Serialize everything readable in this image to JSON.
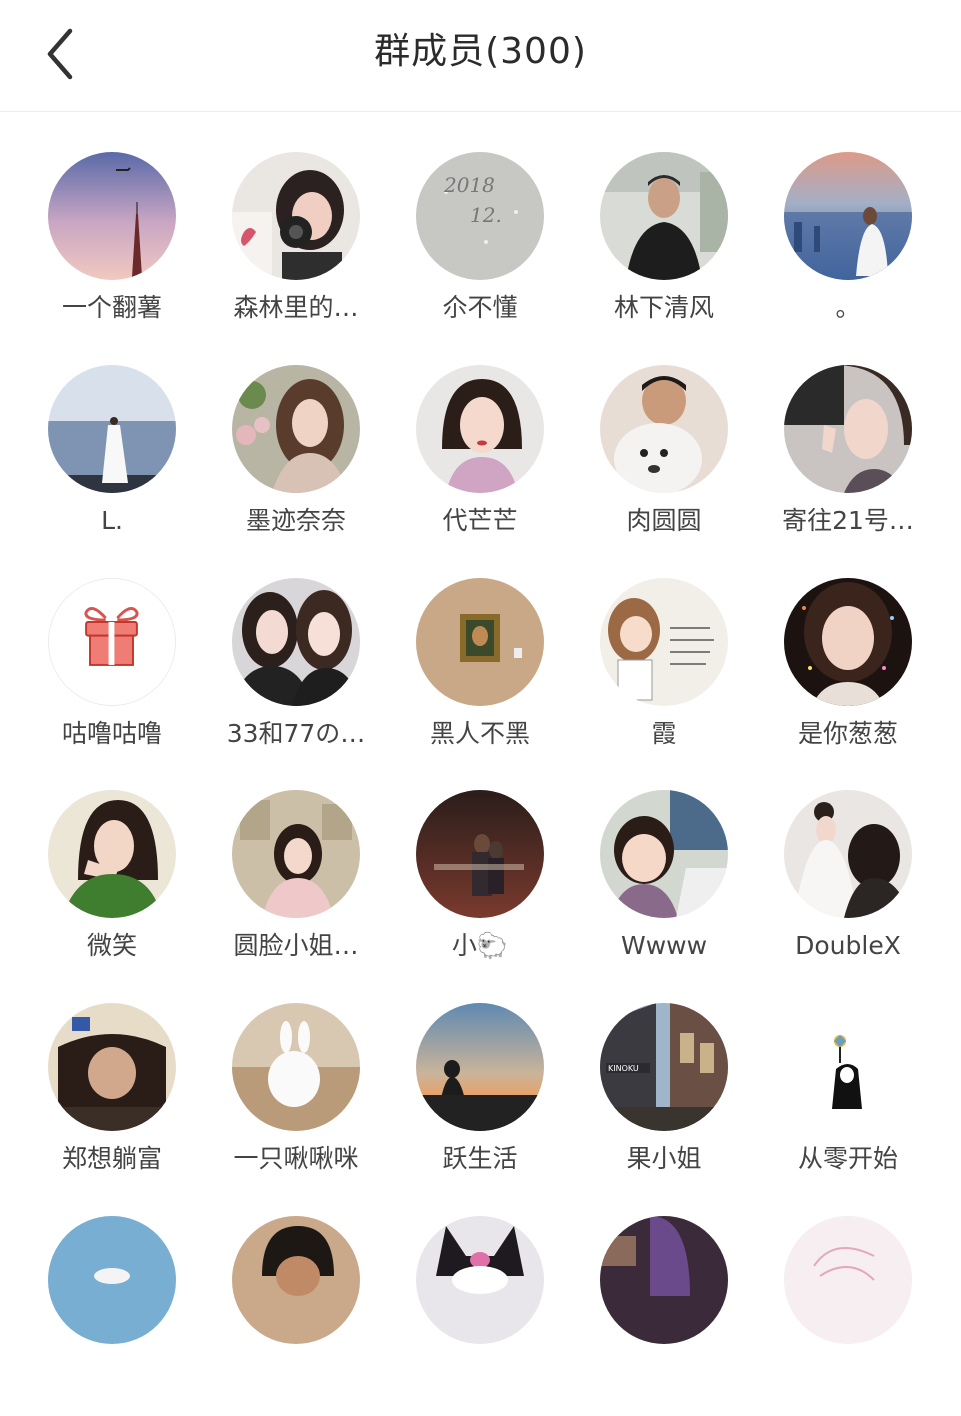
{
  "header": {
    "title": "群成员(300)",
    "back_icon": "chevron-left-icon"
  },
  "members": [
    {
      "name": "一个翻薯",
      "avatar": "sunset-tower-plane"
    },
    {
      "name": "森林里的…",
      "avatar": "girl-with-camera"
    },
    {
      "name": "尒不懂",
      "avatar": "snow-writing-2018"
    },
    {
      "name": "林下清风",
      "avatar": "man-in-office"
    },
    {
      "name": "。",
      "avatar": "city-skyline-view"
    },
    {
      "name": "L.",
      "avatar": "girl-on-seashore"
    },
    {
      "name": "墨迹奈奈",
      "avatar": "girl-with-flowers"
    },
    {
      "name": "代芒芒",
      "avatar": "girl-short-hair"
    },
    {
      "name": "肉圆圆",
      "avatar": "boy-with-dog"
    },
    {
      "name": "寄往21号…",
      "avatar": "girl-selfie"
    },
    {
      "name": "咕噜咕噜",
      "avatar": "gift-icon"
    },
    {
      "name": "33和77の…",
      "avatar": "two-girls"
    },
    {
      "name": "黑人不黑",
      "avatar": "framed-portrait"
    },
    {
      "name": "霞",
      "avatar": "cartoon-girl-text"
    },
    {
      "name": "是你葱葱",
      "avatar": "girl-glitter"
    },
    {
      "name": "微笑",
      "avatar": "girl-green-sweater"
    },
    {
      "name": "圆脸小姐…",
      "avatar": "girl-newspaper-wall"
    },
    {
      "name": "小🐑",
      "avatar": "couple-at-night"
    },
    {
      "name": "Wwww",
      "avatar": "toddler-smiling"
    },
    {
      "name": "DoubleX",
      "avatar": "bride-wedding"
    },
    {
      "name": "郑想躺富",
      "avatar": "man-lying-down"
    },
    {
      "name": "一只啾啾咪",
      "avatar": "white-rabbit"
    },
    {
      "name": "跃生活",
      "avatar": "sunset-silhouette"
    },
    {
      "name": "果小姐",
      "avatar": "city-street"
    },
    {
      "name": "从零开始",
      "avatar": "no-face-pinwheel"
    },
    {
      "name": "",
      "avatar": "sky-partial"
    },
    {
      "name": "",
      "avatar": "boy-partial"
    },
    {
      "name": "",
      "avatar": "kuromi-partial"
    },
    {
      "name": "",
      "avatar": "purple-hair-partial"
    },
    {
      "name": "",
      "avatar": "pink-sketch-partial"
    }
  ]
}
